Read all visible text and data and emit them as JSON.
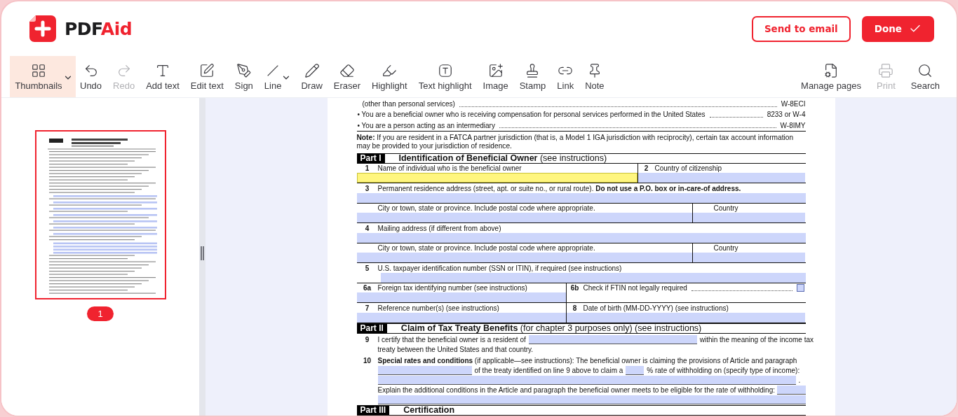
{
  "logo": {
    "prefix": "PDF",
    "suffix": "Aid"
  },
  "header_buttons": [
    {
      "label": "Send to email",
      "kind": "outline"
    },
    {
      "label": "Done",
      "kind": "primary"
    }
  ],
  "toolbar": {
    "tools": [
      {
        "label": "Thumbnails",
        "selected": true,
        "disabled": false,
        "menu": true
      },
      {
        "label": "Undo",
        "selected": false,
        "disabled": false,
        "menu": false
      },
      {
        "label": "Redo",
        "selected": false,
        "disabled": true,
        "menu": false
      },
      {
        "label": "Add text",
        "selected": false,
        "disabled": false,
        "menu": false
      },
      {
        "label": "Edit text",
        "selected": false,
        "disabled": false,
        "menu": false
      },
      {
        "label": "Sign",
        "selected": false,
        "disabled": false,
        "menu": false
      },
      {
        "label": "Line",
        "selected": false,
        "disabled": false,
        "menu": true
      },
      {
        "label": "Draw",
        "selected": false,
        "disabled": false,
        "menu": false
      },
      {
        "label": "Eraser",
        "selected": false,
        "disabled": false,
        "menu": false
      },
      {
        "label": "Highlight",
        "selected": false,
        "disabled": false,
        "menu": false
      },
      {
        "label": "Text highlight",
        "selected": false,
        "disabled": false,
        "menu": false
      },
      {
        "label": "Image",
        "selected": false,
        "disabled": false,
        "menu": false
      },
      {
        "label": "Stamp",
        "selected": false,
        "disabled": false,
        "menu": false
      },
      {
        "label": "Link",
        "selected": false,
        "disabled": false,
        "menu": false
      },
      {
        "label": "Note",
        "selected": false,
        "disabled": false,
        "menu": false
      }
    ],
    "actions": [
      {
        "label": "Manage pages",
        "disabled": false
      },
      {
        "label": "Print",
        "disabled": true
      },
      {
        "label": "Search",
        "disabled": false
      }
    ]
  },
  "sidebar": {
    "pages": [
      {
        "number": "1",
        "selected": true
      }
    ]
  },
  "document": {
    "rows": [
      {
        "kind": "leader",
        "indent": true,
        "text": "(other than personal services)",
        "value": "W-8ECI"
      },
      {
        "kind": "leader",
        "indent": false,
        "text": "• You are a beneficial owner who is receiving compensation for personal services performed in the United States",
        "value": "8233 or W-4"
      },
      {
        "kind": "leader",
        "indent": false,
        "text": "• You are a person acting as an intermediary",
        "value": "W-8IMY"
      },
      {
        "kind": "note",
        "text": "**Note:** If you are resident in a FATCA partner jurisdiction (that is, a Model 1 IGA jurisdiction with reciprocity), certain tax account information may be provided to your jurisdiction of residence."
      },
      {
        "kind": "part",
        "tag": "Part I",
        "title": "**Identification of Beneficial Owner** (see instructions)"
      },
      {
        "kind": "split-wide",
        "cells": [
          {
            "number": "1",
            "label": "Name of individual who is the beneficial owner",
            "focused": true
          },
          {
            "number": "2",
            "label": "Country of citizenship",
            "focused": false
          }
        ]
      },
      {
        "kind": "full",
        "number": "3",
        "label": "Permanent residence address (street, apt. or suite no., or rural route). **Do not use a P.O. box or in-care-of address.**",
        "focused": false
      },
      {
        "kind": "split-address",
        "cells": [
          {
            "label": "City or town, state or province. Include postal code where appropriate.",
            "focused": false
          },
          {
            "label": "Country",
            "focused": false
          }
        ]
      },
      {
        "kind": "full",
        "number": "4",
        "label": "Mailing address (if different from above)",
        "focused": false
      },
      {
        "kind": "split-address",
        "cells": [
          {
            "label": "City or town, state or province. Include postal code where appropriate.",
            "focused": false
          },
          {
            "label": "Country",
            "focused": false
          }
        ]
      },
      {
        "kind": "full-indented",
        "number": "5",
        "label": "U.S. taxpayer identification number (SSN or ITIN), if required (see instructions)",
        "focused": false
      },
      {
        "kind": "split-half",
        "cells": [
          {
            "number": "6a",
            "label": "Foreign tax identifying number (see instructions)",
            "focused": false
          },
          {
            "number": "6b",
            "label": "Check if FTIN not legally required",
            "checked": false
          }
        ]
      },
      {
        "kind": "split-half",
        "cells": [
          {
            "number": "7",
            "label": "Reference number(s) (see instructions)",
            "focused": false
          },
          {
            "number": "8",
            "label": "Date of birth (MM-DD-YYYY) (see instructions)",
            "focused": false
          }
        ]
      },
      {
        "kind": "part",
        "tag": "Part II",
        "title": "**Claim of Tax Treaty Benefits** (for chapter 3 purposes only) (see instructions)"
      },
      {
        "kind": "residence",
        "number": "9",
        "before": "I certify that the beneficial owner is a resident of",
        "after": "within the meaning of the income tax",
        "continuation": "treaty between the United States and that country."
      },
      {
        "kind": "special",
        "number": "10",
        "intro": "**Special rates and conditions** (if applicable—see instructions): The beneficial owner is claiming the provisions of Article and paragraph",
        "middle": "of the treaty identified on line 9 above to claim a",
        "after": "% rate of withholding on (specify type of income):",
        "end": ".",
        "explain": "Explain the additional conditions in the Article and paragraph the beneficial owner meets to be eligible for the rate of withholding:"
      },
      {
        "kind": "part",
        "tag": "Part III",
        "title": "**Certification**"
      }
    ]
  }
}
